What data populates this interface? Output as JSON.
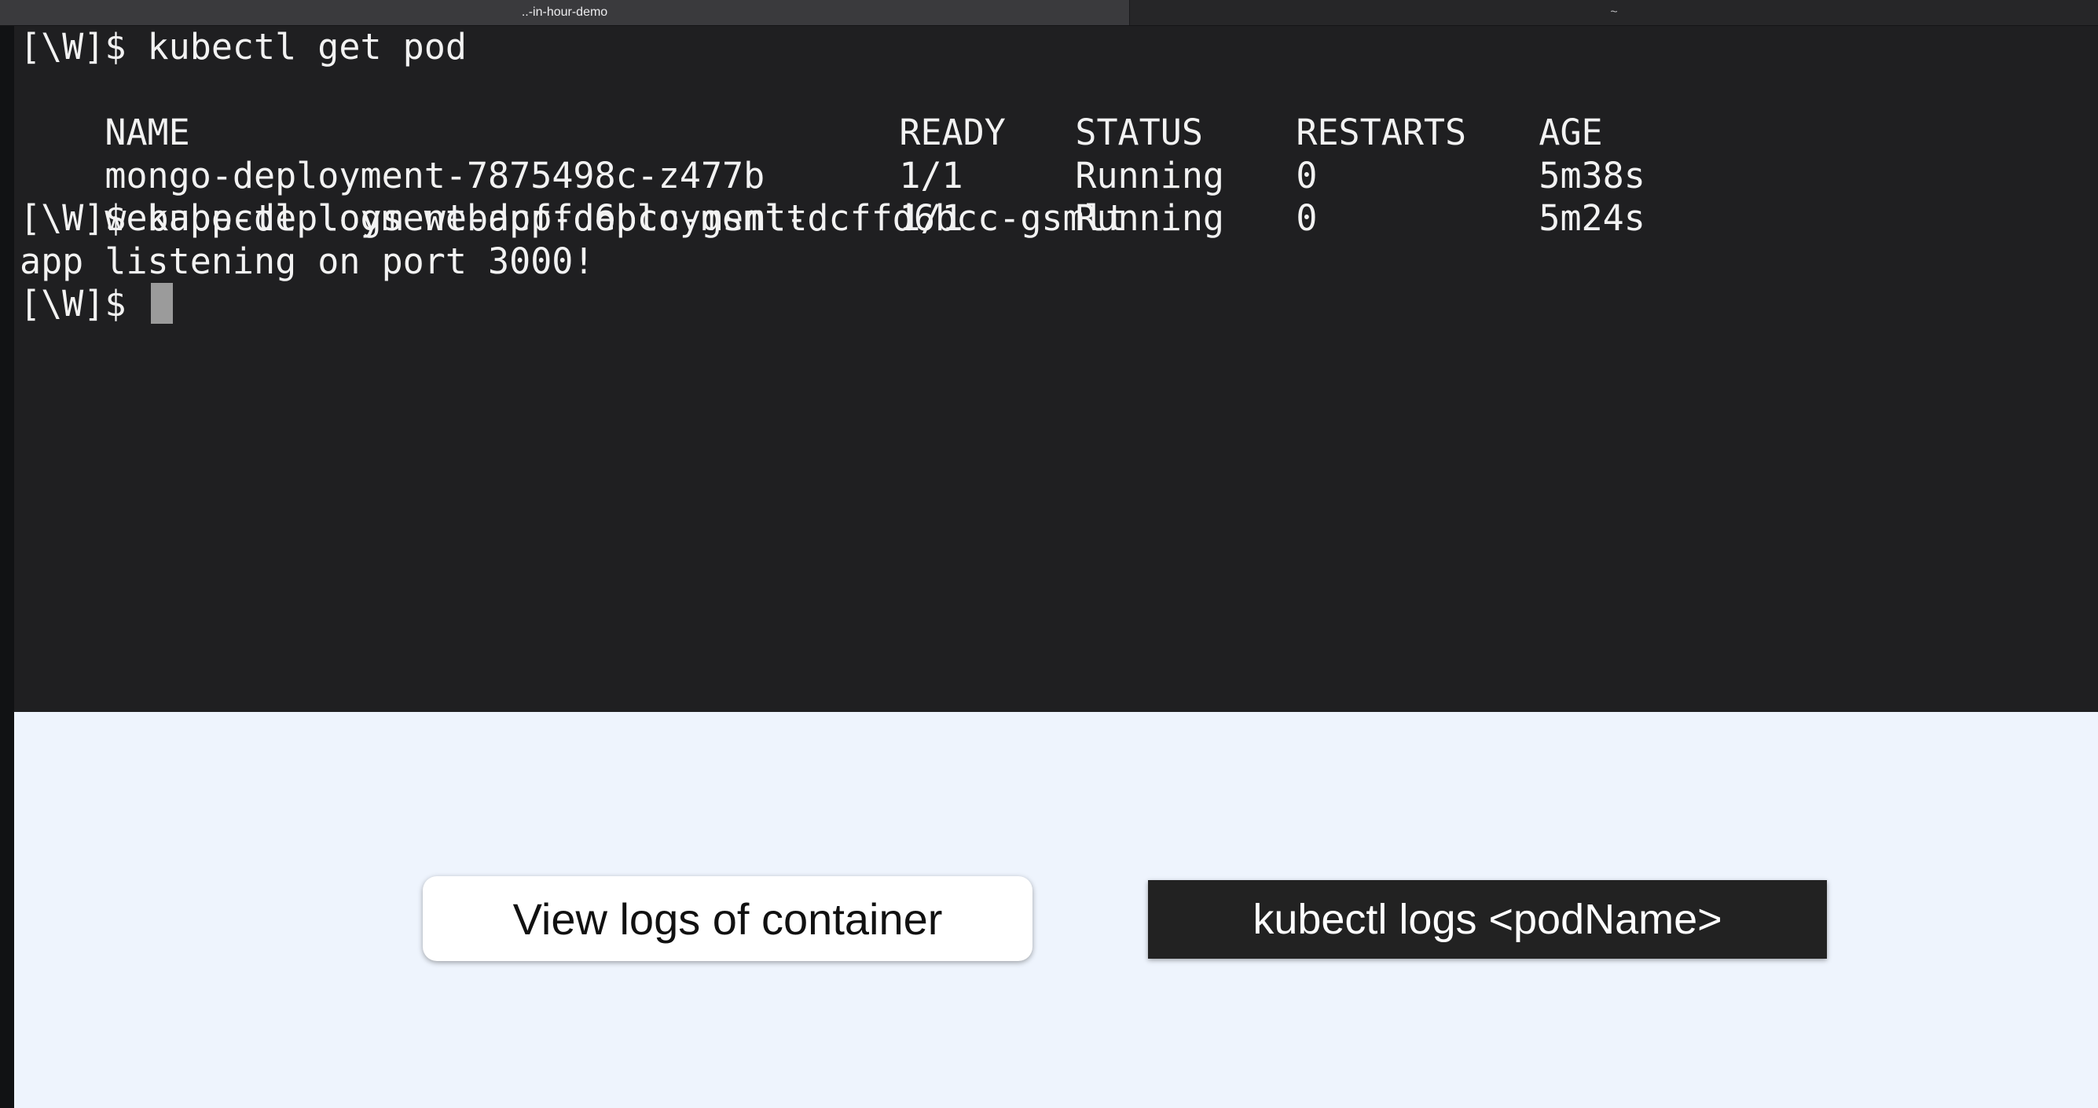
{
  "tabs": [
    {
      "label": "..-in-hour-demo",
      "active": true
    },
    {
      "label": "~",
      "active": false
    }
  ],
  "terminal": {
    "lines": [
      "[\\W]$ kubectl get pod",
      "app listening on port 3000!",
      "[\\W]$ kubectl logs webapp-deployment-dcffd6bcc-gsmlt",
      "[\\W]$ "
    ],
    "table": {
      "headers": [
        "NAME",
        "READY",
        "STATUS",
        "RESTARTS",
        "AGE"
      ],
      "rows": [
        [
          "mongo-deployment-7875498c-z477b",
          "1/1",
          "Running",
          "0",
          "5m38s"
        ],
        [
          "webapp-deployment-dcffd6bcc-gsmlt",
          "1/1",
          "Running",
          "0",
          "5m24s"
        ]
      ]
    }
  },
  "slide": {
    "concept": "View logs of container",
    "command": "kubectl logs <podName>"
  },
  "colors": {
    "terminal_bg": "#1f1f21",
    "terminal_text": "#f2f2f2",
    "slide_bg": "#eef4fd",
    "command_bg": "#222222"
  }
}
